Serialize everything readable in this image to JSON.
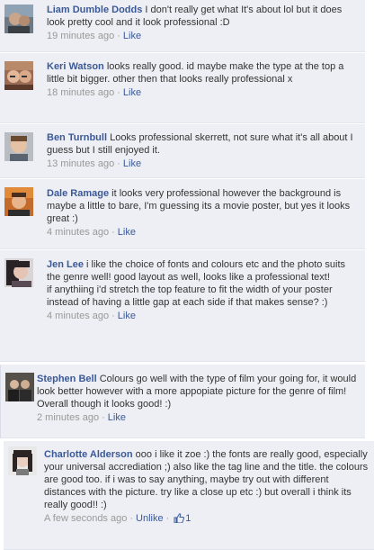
{
  "comments": [
    {
      "author": "Liam Dumble Dodds",
      "text": "I don't really get what It's about lol but it does look pretty cool and it look professional :D",
      "time": "19 minutes ago",
      "action": "Like"
    },
    {
      "author": "Keri Watson",
      "text": "looks really good. id maybe make the type at the top a little bit bigger. other then that looks really professional x",
      "time": "18 minutes ago",
      "action": "Like"
    },
    {
      "author": "Ben Turnbull",
      "text": "Looks professional skerrett, not sure what it's all about I guess but I still enjoyed it.",
      "time": "13 minutes ago",
      "action": "Like"
    },
    {
      "author": "Dale Ramage",
      "text": "it looks very professional however the background is maybe a little to bare, I'm guessing its a movie poster, but yes it looks great :)",
      "time": "4 minutes ago",
      "action": "Like"
    },
    {
      "author": "Jen Lee",
      "text": "i like the choice of fonts and colours etc and the photo suits the genre well! good layout as well, looks like a professional text!",
      "text2": "if anythiing i'd stretch the top feature to fit the width of your poster instead of having a little gap at each side if that makes sense? :)",
      "time": "4 minutes ago",
      "action": "Like"
    },
    {
      "author": "Stephen Bell",
      "text": "Colours go well with the type of film your going for, it would look better however with a more appopiate picture for the genre of film! Overall though it looks good! :)",
      "time": "2 minutes ago",
      "action": "Like"
    },
    {
      "author": "Charlotte Alderson",
      "text": "ooo i like it zoe :) the fonts are really good, especially your universal accrediation ;) also like the tag line and the title. the colours are good too. if i was to say anything, maybe try out with different distances with the picture. try like a close up etc :) but overall i think its really good!! :)",
      "time": "A few seconds ago",
      "action": "Unlike",
      "like_count": "1",
      "like_icon": "thumbs-up-icon"
    }
  ],
  "colors": {
    "link": "#3b5998",
    "meta": "#999999",
    "comment_bg": "#edeff4"
  }
}
